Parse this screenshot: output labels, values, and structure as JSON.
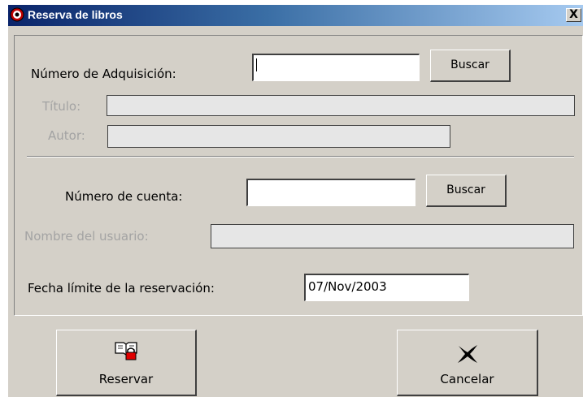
{
  "window": {
    "title": "Reserva de libros",
    "close_symbol": "X"
  },
  "book": {
    "acquisition_label": "Número de Adquisición:",
    "acquisition_value": "",
    "search_label": "Buscar",
    "title_label": "Título:",
    "title_value": "",
    "author_label": "Autor:",
    "author_value": ""
  },
  "user": {
    "account_label": "Número de cuenta:",
    "account_value": "",
    "search_label": "Buscar",
    "name_label": "Nombre del usuario:",
    "name_value": ""
  },
  "reservation": {
    "deadline_label": "Fecha límite de la reservación:",
    "deadline_value": "07/Nov/2003"
  },
  "actions": {
    "reserve_label": "Reservar",
    "reserve_icon": "book-lock-icon",
    "cancel_label": "Cancelar",
    "cancel_icon": "x-icon"
  }
}
